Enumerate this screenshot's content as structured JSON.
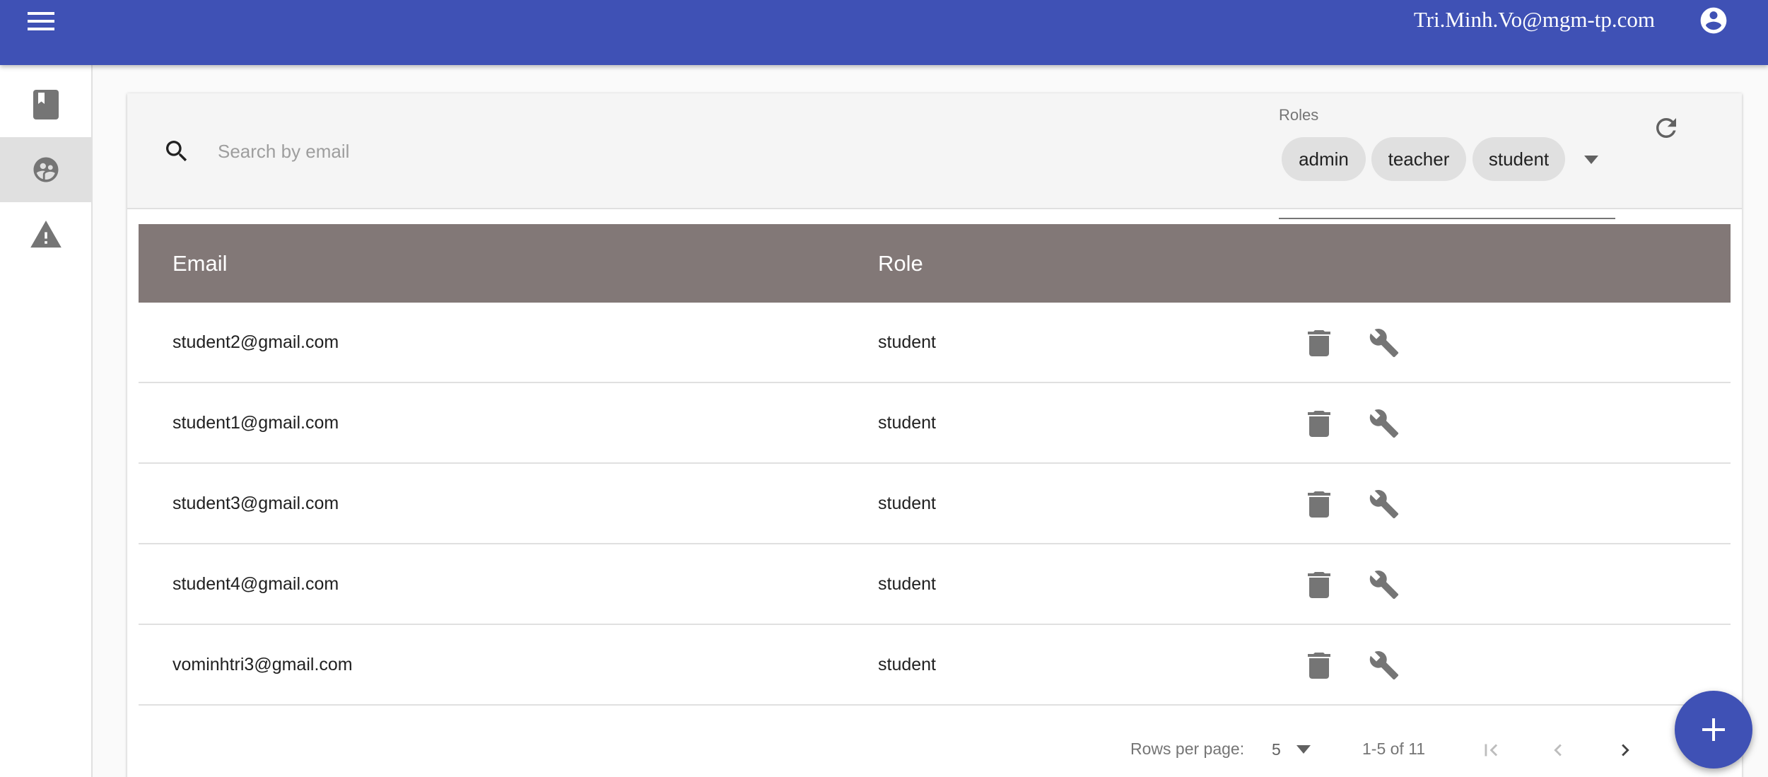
{
  "header": {
    "menu_icon": "hamburger-menu-icon",
    "user_email": "Tri.Minh.Vo@mgm-tp.com",
    "account_icon": "account-circle-icon"
  },
  "sidebar": {
    "items": [
      {
        "icon": "book-icon",
        "active": false
      },
      {
        "icon": "users-icon",
        "active": true
      },
      {
        "icon": "warning-icon",
        "active": false
      }
    ]
  },
  "toolbar": {
    "search_placeholder": "Search by email",
    "search_value": "",
    "roles_label": "Roles",
    "role_chips": [
      "admin",
      "teacher",
      "student"
    ],
    "refresh_icon": "refresh-icon"
  },
  "table": {
    "headers": [
      "Email",
      "Role"
    ],
    "rows": [
      {
        "email": "student2@gmail.com",
        "role": "student"
      },
      {
        "email": "student1@gmail.com",
        "role": "student"
      },
      {
        "email": "student3@gmail.com",
        "role": "student"
      },
      {
        "email": "student4@gmail.com",
        "role": "student"
      },
      {
        "email": "vominhtri3@gmail.com",
        "role": "student"
      }
    ]
  },
  "pagination": {
    "rows_per_page_label": "Rows per page:",
    "rows_per_page_value": "5",
    "range_text": "1-5 of 11"
  },
  "colors": {
    "primary": "#3f51b5",
    "table_header": "#827877",
    "icon_grey": "#757575"
  }
}
